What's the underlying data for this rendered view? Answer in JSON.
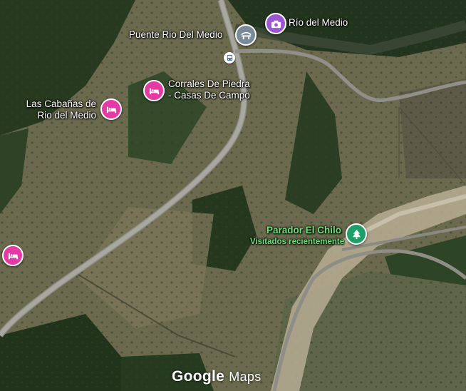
{
  "map": {
    "places": {
      "rio_del_medio": {
        "label": "Río del Medio",
        "category": "camera-icon",
        "color": "#9b59d0"
      },
      "puente": {
        "label": "Puente Rio Del Medio",
        "category": "bridge-icon",
        "color": "#7a8a99"
      },
      "corrales": {
        "label_line1": "Corrales De Piedra",
        "label_line2": "- Casas De Campo",
        "category": "bed-icon",
        "color": "#e53aa3"
      },
      "cabanas": {
        "label_line1": "Las Cabañas de",
        "label_line2": "Rio del Medio",
        "category": "bed-icon",
        "color": "#e53aa3"
      },
      "left_hotel": {
        "category": "bed-icon",
        "color": "#e53aa3"
      },
      "parador": {
        "label": "Parador El Chilo",
        "sublabel": "Visitados recientemente",
        "category": "tree-icon",
        "color": "#1e9e68"
      },
      "bus": {
        "category": "bus-icon"
      }
    },
    "branding": {
      "logo_google": "Google",
      "logo_maps": "Maps"
    }
  }
}
